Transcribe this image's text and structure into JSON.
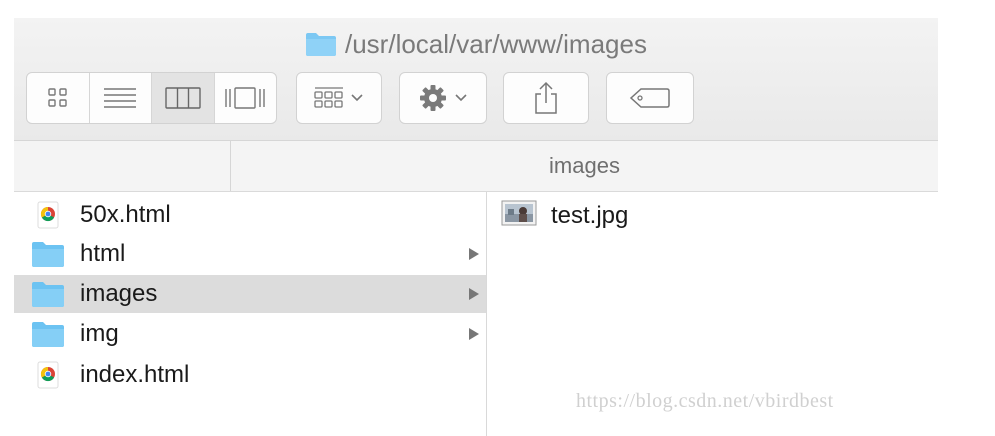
{
  "window": {
    "title": "/usr/local/var/www/images"
  },
  "toolbar": {
    "view_modes": [
      {
        "icon": "icon-view-icon"
      },
      {
        "icon": "list-view-icon"
      },
      {
        "icon": "column-view-icon",
        "active": true
      },
      {
        "icon": "cover-flow-icon"
      }
    ],
    "arrange_icon": "arrange-icon",
    "action_icon": "gear-icon",
    "share_icon": "share-icon",
    "tag_icon": "tag-icon"
  },
  "column_header": "images",
  "columns": [
    {
      "items": [
        {
          "name": "50x.html",
          "type": "chrome-file",
          "arrow": false,
          "selected": false
        },
        {
          "name": "html",
          "type": "folder",
          "arrow": true,
          "selected": false
        },
        {
          "name": "images",
          "type": "folder",
          "arrow": true,
          "selected": true
        },
        {
          "name": "img",
          "type": "folder",
          "arrow": true,
          "selected": false
        },
        {
          "name": "index.html",
          "type": "chrome-file",
          "arrow": false,
          "selected": false
        }
      ]
    },
    {
      "items": [
        {
          "name": "test.jpg",
          "type": "image-file"
        }
      ]
    }
  ],
  "watermark": "https://blog.csdn.net/vbirdbest",
  "colors": {
    "folder": "#6cc3f2",
    "selection": "#dcdcdc",
    "title_text": "#7a7a7a"
  }
}
